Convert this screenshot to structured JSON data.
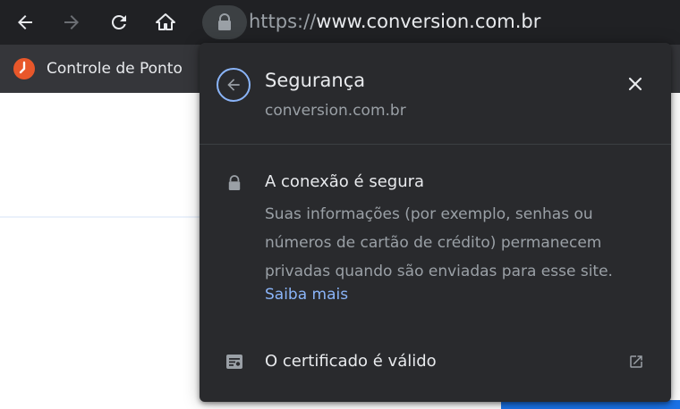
{
  "browser": {
    "url": {
      "scheme": "https://",
      "host": "www.conversion.com.br"
    },
    "bookmarks": [
      {
        "label": "Controle de Ponto",
        "icon": "clock-icon"
      }
    ],
    "icons": [
      "back-arrow-icon",
      "forward-arrow-icon",
      "reload-icon",
      "home-icon",
      "lock-icon"
    ]
  },
  "popup": {
    "title": "Segurança",
    "subtitle": "conversion.com.br",
    "connection": {
      "title": "A conexão é segura",
      "description_lines": [
        "Suas informações (por exemplo, senhas ou",
        "números de cartão de crédito) permanecem",
        "privadas quando são enviadas para esse site."
      ],
      "learn_more": "Saiba mais"
    },
    "certificate": {
      "label": "O certificado é válido"
    }
  },
  "colors": {
    "toolbar_bg": "#202124",
    "bookmarks_bg": "#35363a",
    "popup_bg": "#292a2d",
    "accent": "#8ab4f8",
    "text_primary": "#e8eaed",
    "text_secondary": "#9aa0a6",
    "bookmark_icon": "#e8572a"
  }
}
